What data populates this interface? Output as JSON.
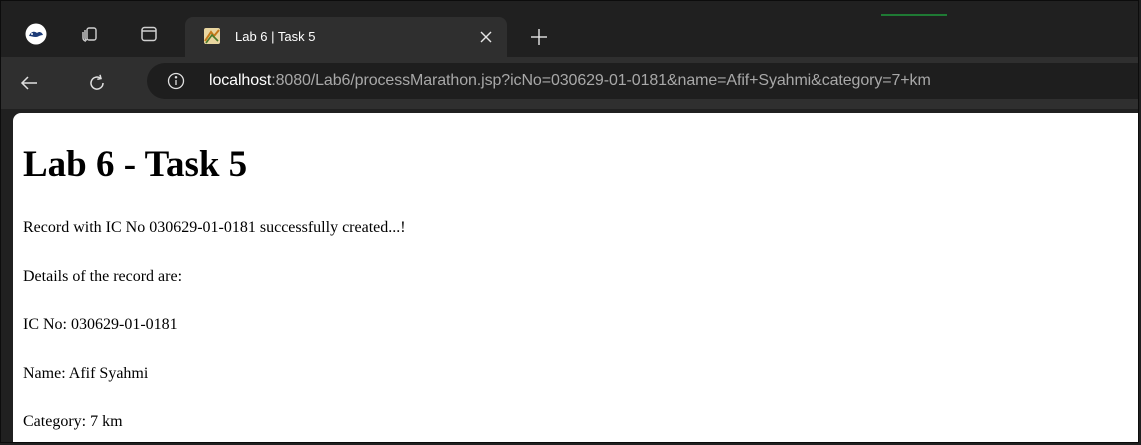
{
  "browser": {
    "tab": {
      "title": "Lab 6 | Task 5"
    },
    "address_bar": {
      "host": "localhost",
      "rest": ":8080/Lab6/processMarathon.jsp?icNo=030629-01-0181&name=Afif+Syahmi&category=7+km"
    },
    "colors": {
      "tab_strip": "#202020",
      "toolbar": "#2f2f2f",
      "omnibox": "#1e1e1e",
      "accent": "#1f7a34"
    },
    "icons": [
      "profile-icon",
      "workspaces-icon",
      "tab-actions-icon",
      "favicon-icon",
      "close-icon",
      "plus-icon",
      "back-arrow-icon",
      "refresh-icon",
      "info-icon"
    ]
  },
  "page": {
    "heading": "Lab 6 - Task 5",
    "message": "Record with IC No 030629-01-0181 successfully created...!",
    "details_intro": "Details of the record are:",
    "ic_line": "IC No: 030629-01-0181",
    "name_line": "Name: Afif Syahmi",
    "category_line": "Category: 7 km"
  }
}
